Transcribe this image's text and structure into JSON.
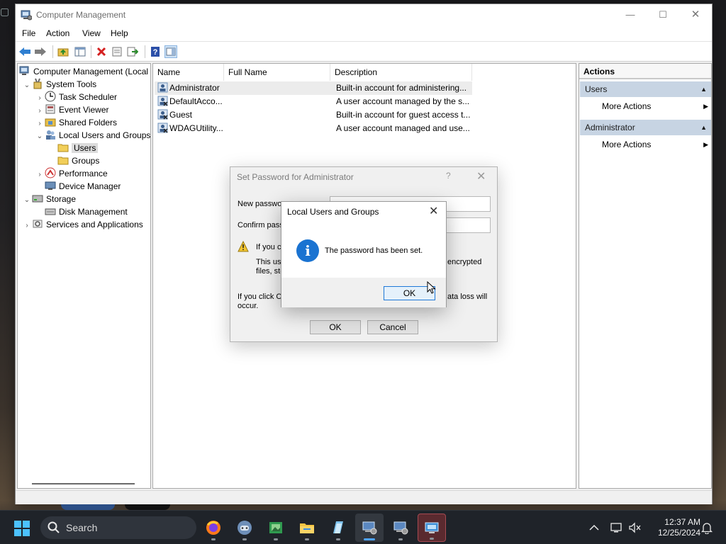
{
  "window": {
    "title": "Computer Management",
    "controls": {
      "minimize": "—",
      "maximize": "☐",
      "close": "✕"
    }
  },
  "menu": [
    "File",
    "Action",
    "View",
    "Help"
  ],
  "toolbar_icons": [
    "back-arrow-icon",
    "forward-arrow-icon",
    "up-folder-icon",
    "show-hide-tree-icon",
    "delete-icon",
    "properties-icon",
    "export-list-icon",
    "help-icon",
    "show-action-pane-icon"
  ],
  "tree": {
    "root": "Computer Management (Local",
    "system_tools": "System Tools",
    "task_scheduler": "Task Scheduler",
    "event_viewer": "Event Viewer",
    "shared_folders": "Shared Folders",
    "local_users_groups": "Local Users and Groups",
    "users": "Users",
    "groups": "Groups",
    "performance": "Performance",
    "device_manager": "Device Manager",
    "storage": "Storage",
    "disk_management": "Disk Management",
    "services_apps": "Services and Applications"
  },
  "list": {
    "columns": [
      "Name",
      "Full Name",
      "Description"
    ],
    "rows": [
      {
        "name": "Administrator",
        "full_name": "",
        "description": "Built-in account for administering..."
      },
      {
        "name": "DefaultAcco...",
        "full_name": "",
        "description": "A user account managed by the s..."
      },
      {
        "name": "Guest",
        "full_name": "",
        "description": "Built-in account for guest access t..."
      },
      {
        "name": "WDAGUtility...",
        "full_name": "",
        "description": "A user account managed and use..."
      }
    ]
  },
  "actions": {
    "title": "Actions",
    "sections": [
      {
        "label": "Users",
        "item": "More Actions"
      },
      {
        "label": "Administrator",
        "item": "More Actions"
      }
    ]
  },
  "set_password_dialog": {
    "title": "Set Password for Administrator",
    "help": "?",
    "close": "✕",
    "new_password_label": "New passwo",
    "confirm_password_label": "Confirm passw",
    "warning_line1": "If you cli",
    "warning_line2a": "This use",
    "warning_line2b": "encrypted",
    "warning_line3": "files, sto",
    "footer_line1a": "If you click C",
    "footer_line1b": "ata loss will",
    "footer_line2": "occur.",
    "ok": "OK",
    "cancel": "Cancel"
  },
  "message_box": {
    "title": "Local Users and Groups",
    "close": "✕",
    "icon_glyph": "i",
    "message": "The password has been set.",
    "ok": "OK",
    "accent": "#1a73d1"
  },
  "taskbar": {
    "search_label": "Search",
    "apps": [
      "firefox-icon",
      "game-controller-icon",
      "image-viewer-icon",
      "file-explorer-icon",
      "notepad-icon",
      "computer-management-icon",
      "computer-management-icon",
      "remote-desktop-icon"
    ],
    "time": "12:37 AM",
    "date": "12/25/2024"
  }
}
